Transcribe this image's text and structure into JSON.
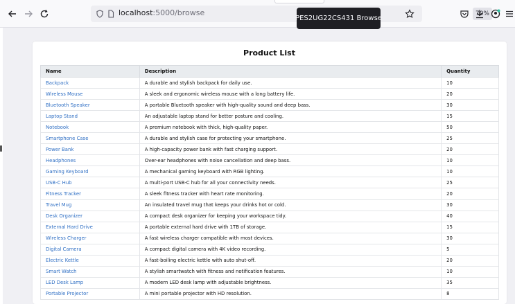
{
  "browser": {
    "url_host": "localhost",
    "url_path": ":5000/browse",
    "zoom": "70%",
    "tooltip": "PES2UG22CS431 Browse"
  },
  "page": {
    "title": "Product List",
    "columns": [
      "Name",
      "Description",
      "Quantity"
    ],
    "rows": [
      {
        "name": "Backpack",
        "description": "A durable and stylish backpack for daily use.",
        "quantity": "10"
      },
      {
        "name": "Wireless Mouse",
        "description": "A sleek and ergonomic wireless mouse with a long battery life.",
        "quantity": "20"
      },
      {
        "name": "Bluetooth Speaker",
        "description": "A portable Bluetooth speaker with high-quality sound and deep bass.",
        "quantity": "30"
      },
      {
        "name": "Laptop Stand",
        "description": "An adjustable laptop stand for better posture and cooling.",
        "quantity": "15"
      },
      {
        "name": "Notebook",
        "description": "A premium notebook with thick, high-quality paper.",
        "quantity": "50"
      },
      {
        "name": "Smartphone Case",
        "description": "A durable and stylish case for protecting your smartphone.",
        "quantity": "25"
      },
      {
        "name": "Power Bank",
        "description": "A high-capacity power bank with fast charging support.",
        "quantity": "20"
      },
      {
        "name": "Headphones",
        "description": "Over-ear headphones with noise cancellation and deep bass.",
        "quantity": "10"
      },
      {
        "name": "Gaming Keyboard",
        "description": "A mechanical gaming keyboard with RGB lighting.",
        "quantity": "10"
      },
      {
        "name": "USB-C Hub",
        "description": "A multi-port USB-C hub for all your connectivity needs.",
        "quantity": "25"
      },
      {
        "name": "Fitness Tracker",
        "description": "A sleek fitness tracker with heart rate monitoring.",
        "quantity": "20"
      },
      {
        "name": "Travel Mug",
        "description": "An insulated travel mug that keeps your drinks hot or cold.",
        "quantity": "30"
      },
      {
        "name": "Desk Organizer",
        "description": "A compact desk organizer for keeping your workspace tidy.",
        "quantity": "40"
      },
      {
        "name": "External Hard Drive",
        "description": "A portable external hard drive with 1TB of storage.",
        "quantity": "15"
      },
      {
        "name": "Wireless Charger",
        "description": "A fast wireless charger compatible with most devices.",
        "quantity": "30"
      },
      {
        "name": "Digital Camera",
        "description": "A compact digital camera with 4K video recording.",
        "quantity": "5"
      },
      {
        "name": "Electric Kettle",
        "description": "A fast-boiling electric kettle with auto shut-off.",
        "quantity": "20"
      },
      {
        "name": "Smart Watch",
        "description": "A stylish smartwatch with fitness and notification features.",
        "quantity": "10"
      },
      {
        "name": "LED Desk Lamp",
        "description": "A modern LED desk lamp with adjustable brightness.",
        "quantity": "35"
      },
      {
        "name": "Portable Projector",
        "description": "A mini portable projector with HD resolution.",
        "quantity": "8"
      }
    ]
  },
  "colors": {
    "link": "#2f6fc4",
    "header_bg": "#e9ecef",
    "tooltip_bg": "#1f1f24"
  }
}
